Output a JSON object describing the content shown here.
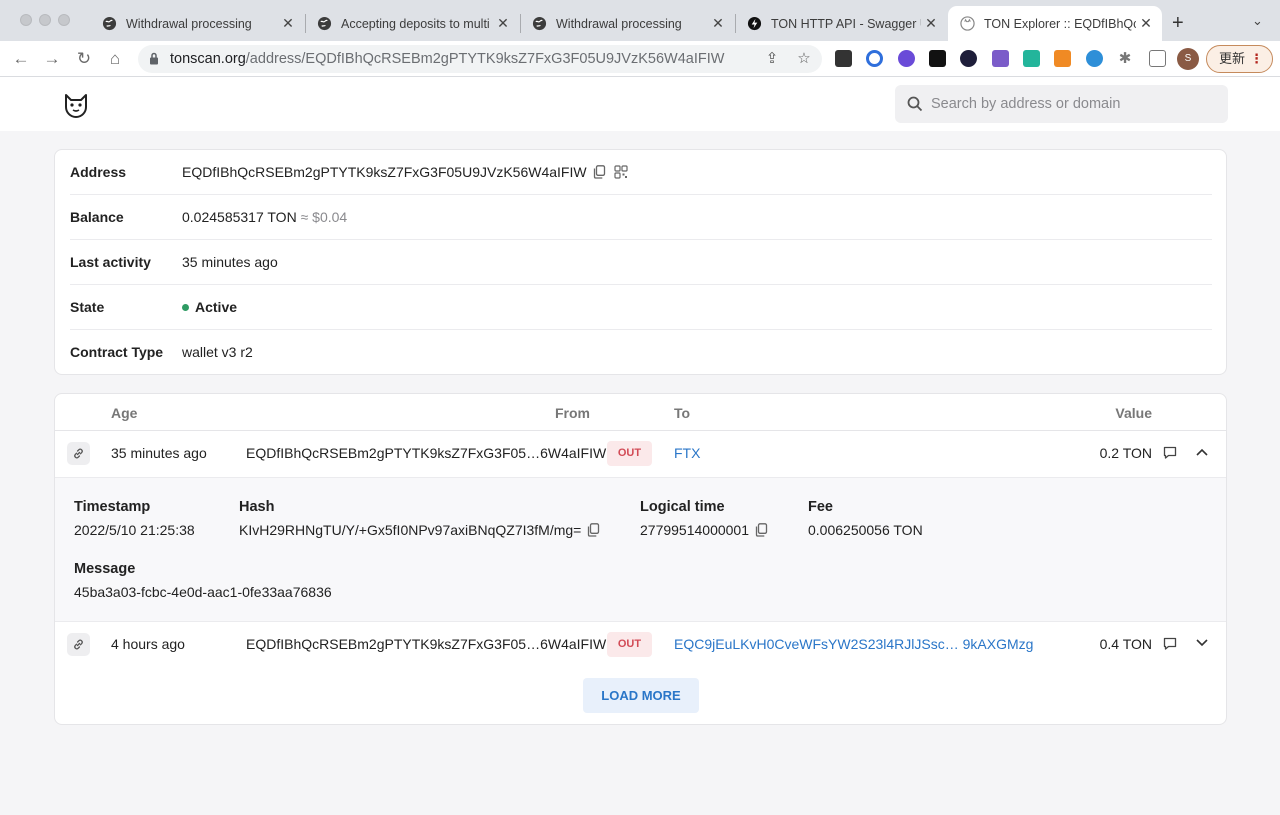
{
  "browser": {
    "tabs": [
      {
        "title": "Withdrawal processing"
      },
      {
        "title": "Accepting deposits to multi"
      },
      {
        "title": "Withdrawal processing"
      },
      {
        "title": "TON HTTP API - Swagger UI"
      },
      {
        "title": "TON Explorer :: EQDfIBhQc"
      }
    ],
    "new_tab": "+",
    "url_host": "tonscan.org",
    "url_path": "/address/EQDfIBhQcRSEBm2gPTYTK9ksZ7FxG3F05U9JVzK56W4aIFIW",
    "profile_initial": "S",
    "update_label": "更新"
  },
  "header": {
    "search_placeholder": "Search by address or domain"
  },
  "address_info": {
    "address_label": "Address",
    "address": "EQDfIBhQcRSEBm2gPTYTK9ksZ7FxG3F05U9JVzK56W4aIFIW",
    "balance_label": "Balance",
    "balance": "0.024585317 TON",
    "balance_fiat": "≈ $0.04",
    "last_activity_label": "Last activity",
    "last_activity": "35 minutes ago",
    "state_label": "State",
    "state": "Active",
    "contract_type_label": "Contract Type",
    "contract_type": "wallet v3 r2"
  },
  "transactions": {
    "columns": {
      "age": "Age",
      "from": "From",
      "to": "To",
      "value": "Value"
    },
    "rows": [
      {
        "age": "35 minutes ago",
        "from": "EQDfIBhQcRSEBm2gPTYTK9ksZ7FxG3F05…6W4aIFIW",
        "direction": "OUT",
        "to": "FTX",
        "value": "0.2 TON",
        "expanded": true
      },
      {
        "age": "4 hours ago",
        "from": "EQDfIBhQcRSEBm2gPTYTK9ksZ7FxG3F05…6W4aIFIW",
        "direction": "OUT",
        "to": "EQC9jEuLKvH0CveWFsYW2S23l4RJlJSsc… 9kAXGMzg",
        "value": "0.4 TON",
        "expanded": false
      }
    ],
    "detail": {
      "timestamp_label": "Timestamp",
      "timestamp": "2022/5/10 21:25:38",
      "hash_label": "Hash",
      "hash": "KIvH29RHNgTU/Y/+Gx5fI0NPv97axiBNqQZ7I3fM/mg=",
      "lt_label": "Logical time",
      "lt": "27799514000001",
      "fee_label": "Fee",
      "fee": "0.006250056 TON",
      "message_label": "Message",
      "message": "45ba3a03-fcbc-4e0d-aac1-0fe33aa76836"
    },
    "load_more": "LOAD MORE"
  },
  "colors": {
    "accent": "#2a76c8",
    "active_green": "#2e9b63",
    "out_badge_bg": "#fbe9ea",
    "out_badge_text": "#d24b56"
  }
}
